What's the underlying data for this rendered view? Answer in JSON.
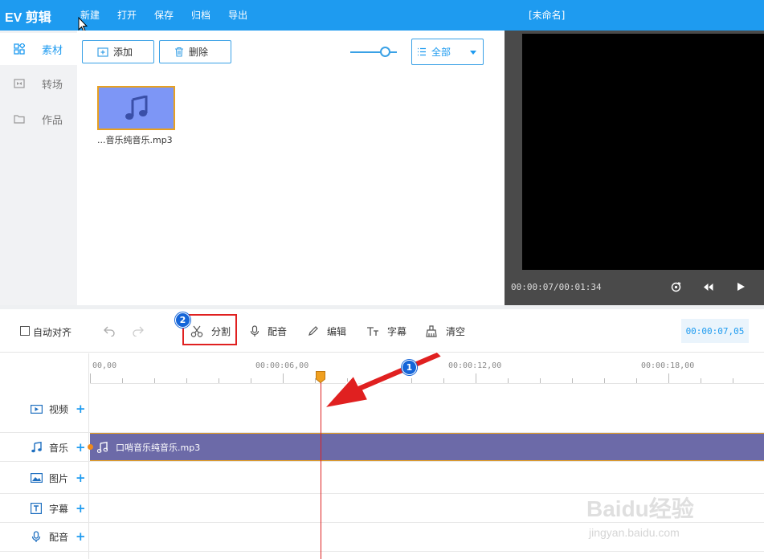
{
  "app": {
    "logo": "EV 剪辑",
    "doc_title": "[未命名]"
  },
  "menu": [
    "新建",
    "打开",
    "保存",
    "归档",
    "导出"
  ],
  "sidebar": {
    "items": [
      {
        "label": "素材",
        "active": true
      },
      {
        "label": "转场",
        "active": false
      },
      {
        "label": "作品",
        "active": false
      }
    ]
  },
  "media": {
    "add_label": "添加",
    "delete_label": "删除",
    "filter_selected": "全部",
    "items": [
      {
        "name": "...音乐纯音乐.mp3"
      }
    ]
  },
  "preview": {
    "time": "00:00:07/00:01:34"
  },
  "toolbar": {
    "auto_align": "自动对齐",
    "split": "分割",
    "dub": "配音",
    "edit": "编辑",
    "subtitle": "字幕",
    "clear": "清空",
    "timecode": "00:00:07,05"
  },
  "annotations": {
    "badge1": "1",
    "badge2": "2"
  },
  "timeline": {
    "ruler": [
      "00,00",
      "00:00:06,00",
      "00:00:12,00",
      "00:00:18,00"
    ],
    "tracks": [
      "视频",
      "音乐",
      "图片",
      "字幕",
      "配音"
    ],
    "music_clip": "口哨音乐纯音乐.mp3"
  },
  "watermark": {
    "brand": "Baidu经验",
    "url": "jingyan.baidu.com"
  },
  "colors": {
    "accent": "#1e9bf0",
    "clip": "#6c6aa8",
    "playhead": "#dd2222",
    "annotation": "#e02020"
  }
}
